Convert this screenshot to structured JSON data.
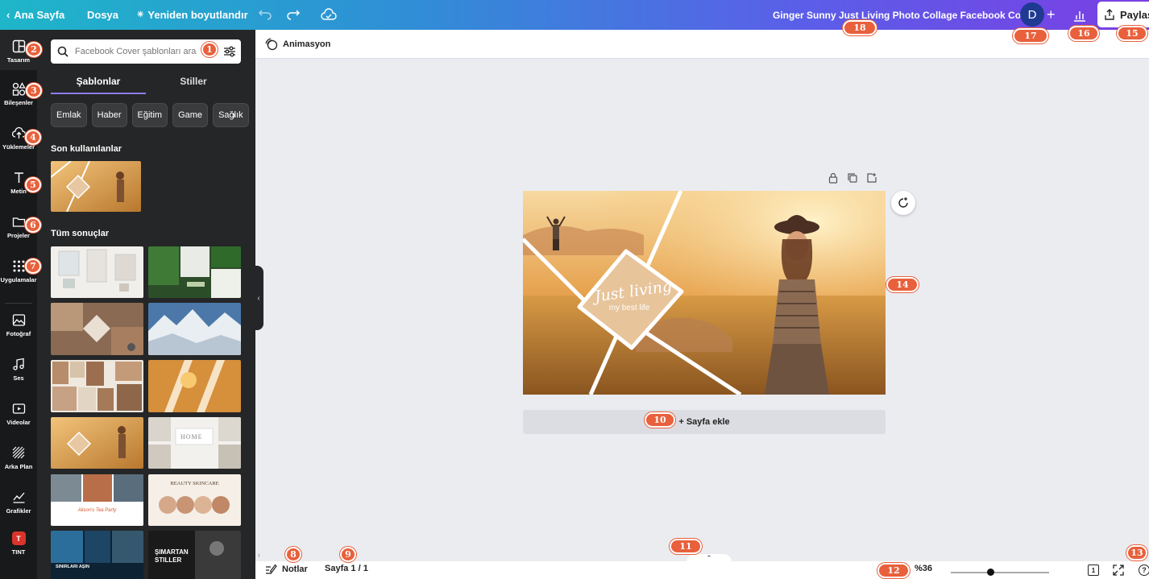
{
  "topbar": {
    "home_label": "Ana Sayfa",
    "file_label": "Dosya",
    "resize_label": "Yeniden boyutlandır",
    "doc_title": "Ginger Sunny Just Living Photo Collage Facebook Cover",
    "avatar_letter": "D",
    "add_label": "+",
    "share_label": "Paylaş"
  },
  "rail": {
    "items": [
      {
        "label": "Tasarım",
        "icon": "layout-icon"
      },
      {
        "label": "Bileşenler",
        "icon": "shapes-icon"
      },
      {
        "label": "Yüklemeler",
        "icon": "cloud-upload-icon"
      },
      {
        "label": "Metin",
        "icon": "text-icon"
      },
      {
        "label": "Projeler",
        "icon": "folder-icon"
      },
      {
        "label": "Uygulamalar",
        "icon": "apps-grid-icon"
      },
      {
        "label": "Fotoğraf",
        "icon": "image-icon"
      },
      {
        "label": "Ses",
        "icon": "music-icon"
      },
      {
        "label": "Videolar",
        "icon": "video-icon"
      },
      {
        "label": "Arka Plan",
        "icon": "pattern-icon"
      },
      {
        "label": "Grafikler",
        "icon": "chart-line-icon"
      },
      {
        "label": "TINT",
        "icon": "tint-app-icon"
      }
    ]
  },
  "panel": {
    "search_placeholder": "Facebook Cover şablonları ara",
    "tabs": [
      "Şablonlar",
      "Stiller"
    ],
    "chips": [
      "Emlak",
      "Haber",
      "Eğitim",
      "Game",
      "Sağlık"
    ],
    "recent_title": "Son kullanılanlar",
    "all_title": "Tüm sonuçlar",
    "template_texts": {
      "home": "HOME",
      "beauty": "BEAUTY SKINCARE",
      "tea_party": "Alison's Tea Party",
      "sinirlari": "SINIRLARI AŞIN",
      "simartan": "ŞIMARTAN",
      "stiller": "STILLER"
    }
  },
  "subbar": {
    "animation_label": "Animasyon"
  },
  "design": {
    "script_text": "Just living",
    "tagline": "my best life"
  },
  "canvas": {
    "add_page_label": "+ Sayfa ekle"
  },
  "bottombar": {
    "notes_label": "Notlar",
    "page_label": "Sayfa 1 / 1",
    "zoom_label": "%36",
    "zoom_fraction": 0.36,
    "page_count_icon_label": "1"
  },
  "badges": [
    "1",
    "2",
    "3",
    "4",
    "5",
    "6",
    "7",
    "8",
    "9",
    "10",
    "11",
    "12",
    "13",
    "14",
    "15",
    "16",
    "17",
    "18"
  ],
  "colors": {
    "accent": "#8b7cf6",
    "badge": "#e8603c",
    "rail_bg": "#18191b",
    "panel_bg": "#252627"
  }
}
